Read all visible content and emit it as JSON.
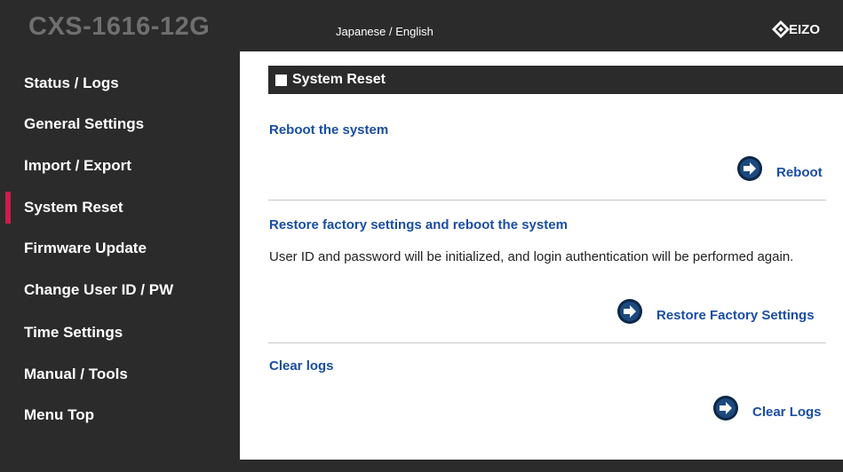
{
  "header": {
    "model": "CXS-1616-12G",
    "language_link": "Japanese / English",
    "logo_text": "EIZO"
  },
  "sidebar": {
    "items": [
      {
        "label": "Status / Logs",
        "active": false
      },
      {
        "label": "General Settings",
        "active": false
      },
      {
        "label": "Import / Export",
        "active": false
      },
      {
        "label": "System Reset",
        "active": true
      },
      {
        "label": "Firmware Update",
        "active": false
      },
      {
        "label": "Change User ID / PW",
        "active": false
      },
      {
        "label": "Time Settings",
        "active": false
      },
      {
        "label": "Manual / Tools",
        "active": false
      },
      {
        "label": "Menu Top",
        "active": false
      }
    ]
  },
  "main": {
    "section_title": "System Reset",
    "reboot": {
      "heading": "Reboot the system",
      "button": "Reboot"
    },
    "factory": {
      "heading": "Restore factory settings and reboot the system",
      "description": "User ID and password will be initialized, and login authentication will be performed again.",
      "button": "Restore Factory Settings"
    },
    "logs": {
      "heading": "Clear logs",
      "button": "Clear Logs"
    }
  },
  "colors": {
    "chrome": "#2b2b2b",
    "accent_marker": "#cc1c4e",
    "link_blue": "#1a4ea3"
  }
}
